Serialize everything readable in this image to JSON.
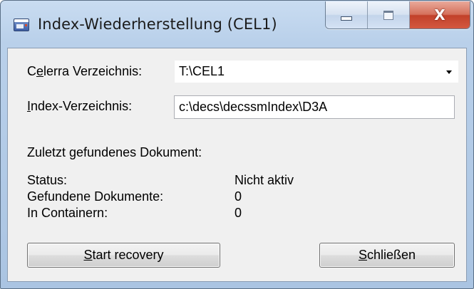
{
  "window": {
    "title": "Index-Wiederherstellung (CEL1)",
    "caption_buttons": {
      "close_glyph": "X"
    },
    "icons": {
      "app": "app-window-icon",
      "minimize": "minimize-icon",
      "maximize": "maximize-icon",
      "close": "close-icon"
    },
    "colors": {
      "frame": "#b9d0ea",
      "close": "#c2412a",
      "client": "#f0f0f0"
    }
  },
  "form": {
    "celerra": {
      "label_before": "C",
      "label_accel": "e",
      "label_after": "lerra Verzeichnis:",
      "value": "T:\\CEL1"
    },
    "index": {
      "label_accel": "I",
      "label_after": "ndex-Verzeichnis:",
      "value": "c:\\decs\\decssmIndex\\D3A"
    },
    "last_found_label": "Zuletzt gefundenes Dokument:",
    "status_label": "Status:",
    "status_value": "Nicht aktiv",
    "found_label": "Gefundene Dokumente:",
    "found_value": "0",
    "containers_label": "In Containern:",
    "containers_value": "0"
  },
  "buttons": {
    "start": {
      "accel": "S",
      "rest": "tart recovery"
    },
    "close": {
      "accel": "S",
      "rest": "chließen"
    }
  }
}
